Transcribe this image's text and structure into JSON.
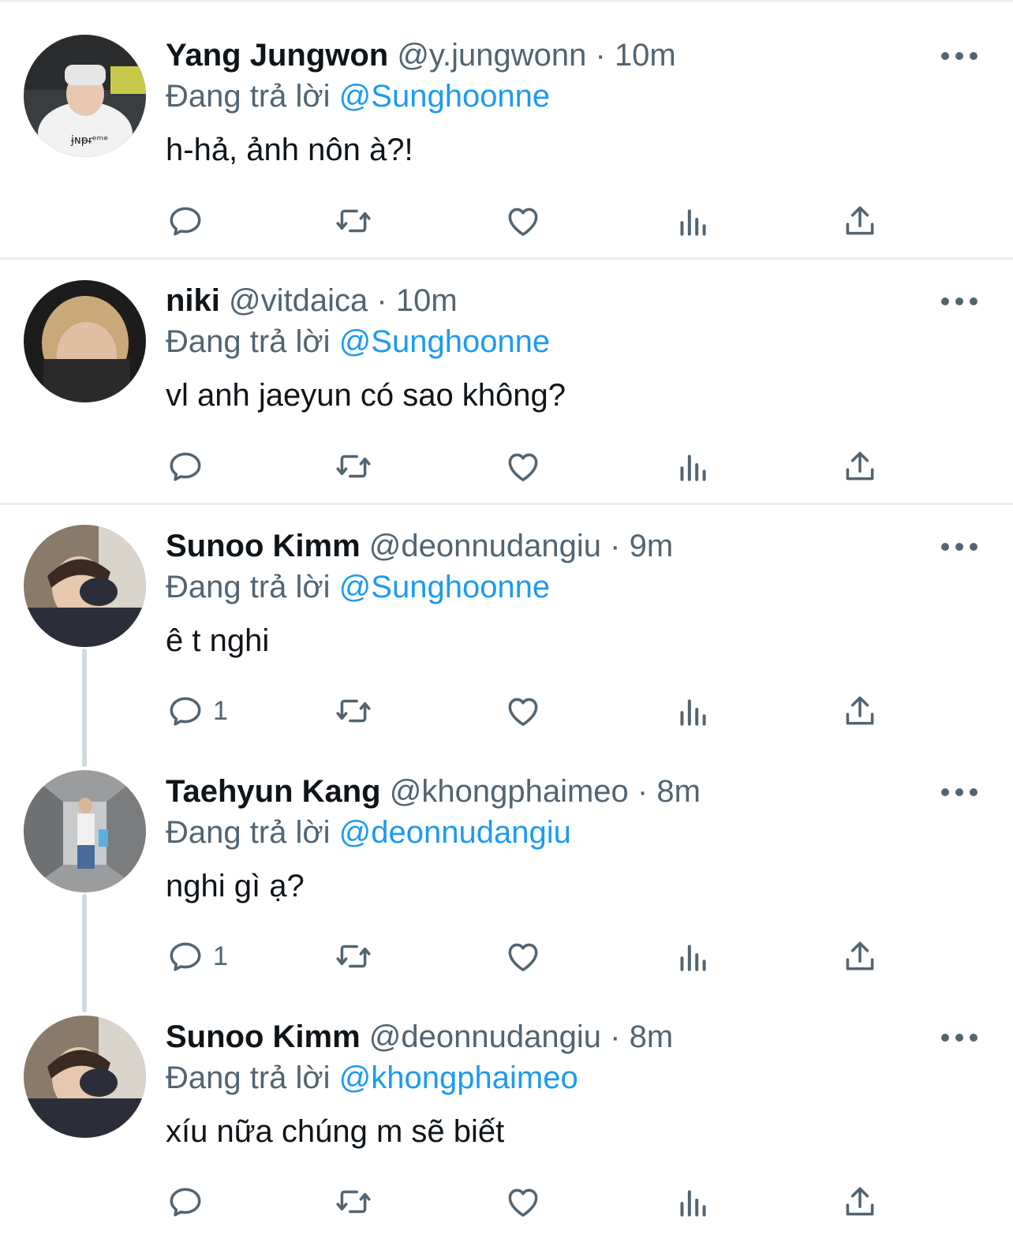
{
  "replying_prefix": "Đang trả lời",
  "tweets": [
    {
      "name": "Yang Jungwon",
      "handle": "@y.jungwonn",
      "dot": "·",
      "time": "10m",
      "reply_to": "@Sunghoonne",
      "text": "h-hả, ảnh nôn à?!",
      "reply_count": ""
    },
    {
      "name": "niki",
      "handle": "@vitdaica",
      "dot": "·",
      "time": "10m",
      "reply_to": "@Sunghoonne",
      "text": "vl anh jaeyun có sao không?",
      "reply_count": ""
    },
    {
      "name": "Sunoo Kimm",
      "handle": "@deonnudangiu",
      "dot": "·",
      "time": "9m",
      "reply_to": "@Sunghoonne",
      "text": "ê t nghi",
      "reply_count": "1"
    },
    {
      "name": "Taehyun Kang",
      "handle": "@khongphaimeo",
      "dot": "·",
      "time": "8m",
      "reply_to": "@deonnudangiu",
      "text": "nghi gì ạ?",
      "reply_count": "1"
    },
    {
      "name": "Sunoo Kimm",
      "handle": "@deonnudangiu",
      "dot": "·",
      "time": "8m",
      "reply_to": "@khongphaimeo",
      "text": "xíu nữa chúng m sẽ biết",
      "reply_count": ""
    }
  ],
  "icons": {
    "more": "more-horizontal-icon",
    "reply": "reply-bubble-icon",
    "retweet": "retweet-icon",
    "like": "heart-icon",
    "views": "analytics-bars-icon",
    "share": "share-upload-icon"
  },
  "colors": {
    "accent": "#1d9bf0",
    "secondary_text": "#536471",
    "primary_text": "#0f1419",
    "separator": "#e6ecf0",
    "thread_line": "#cfd9de"
  }
}
